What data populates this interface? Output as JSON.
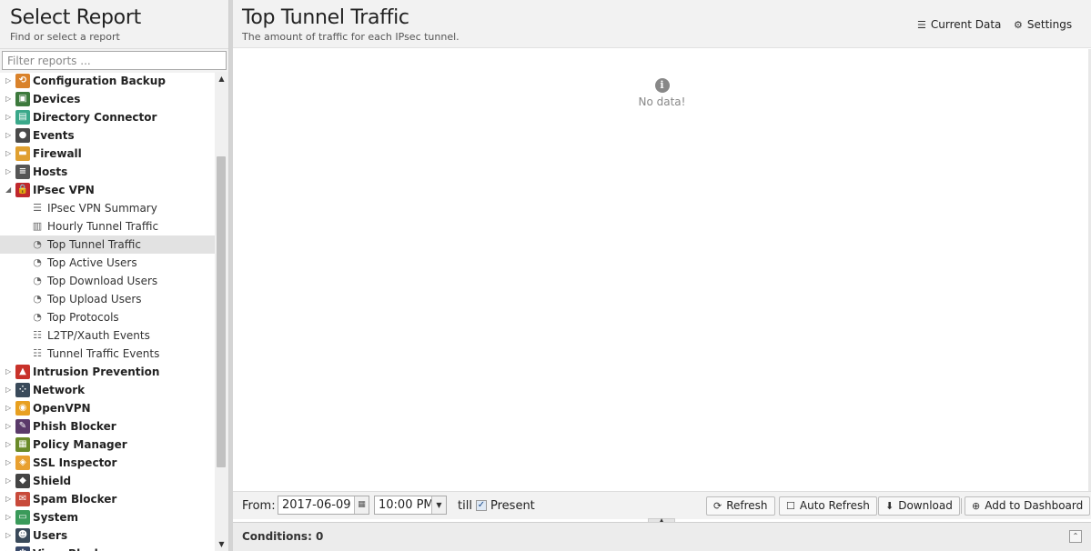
{
  "sidebar": {
    "title": "Select Report",
    "subtitle": "Find or select a report",
    "filter_placeholder": "Filter reports ...",
    "categories": [
      {
        "label": "Configuration Backup",
        "icon": "config-backup-icon",
        "color": "#d9822b",
        "glyph": "⟲",
        "expanded": false
      },
      {
        "label": "Devices",
        "icon": "devices-icon",
        "color": "#3d7a3d",
        "glyph": "▣",
        "expanded": false
      },
      {
        "label": "Directory Connector",
        "icon": "directory-connector-icon",
        "color": "#3aa88a",
        "glyph": "▤",
        "expanded": false
      },
      {
        "label": "Events",
        "icon": "events-icon",
        "color": "#4a4a4a",
        "glyph": "●",
        "expanded": false
      },
      {
        "label": "Firewall",
        "icon": "firewall-icon",
        "color": "#e0a030",
        "glyph": "▬",
        "expanded": false
      },
      {
        "label": "Hosts",
        "icon": "hosts-icon",
        "color": "#555555",
        "glyph": "≡",
        "expanded": false
      },
      {
        "label": "IPsec VPN",
        "icon": "ipsec-vpn-icon",
        "color": "#c0282d",
        "glyph": "🔒",
        "expanded": true,
        "children": [
          {
            "label": "IPsec VPN Summary",
            "icon": "text-lines-icon",
            "glyph": "☰"
          },
          {
            "label": "Hourly Tunnel Traffic",
            "icon": "bar-chart-icon",
            "glyph": "▥"
          },
          {
            "label": "Top Tunnel Traffic",
            "icon": "pie-chart-icon",
            "glyph": "◔",
            "selected": true
          },
          {
            "label": "Top Active Users",
            "icon": "pie-chart-icon",
            "glyph": "◔"
          },
          {
            "label": "Top Download Users",
            "icon": "pie-chart-icon",
            "glyph": "◔"
          },
          {
            "label": "Top Upload Users",
            "icon": "pie-chart-icon",
            "glyph": "◔"
          },
          {
            "label": "Top Protocols",
            "icon": "pie-chart-icon",
            "glyph": "◔"
          },
          {
            "label": "L2TP/Xauth Events",
            "icon": "list-icon",
            "glyph": "☷"
          },
          {
            "label": "Tunnel Traffic Events",
            "icon": "list-icon",
            "glyph": "☷"
          }
        ]
      },
      {
        "label": "Intrusion Prevention",
        "icon": "intrusion-prevention-icon",
        "color": "#c8322a",
        "glyph": "▲",
        "expanded": false
      },
      {
        "label": "Network",
        "icon": "network-icon",
        "color": "#3a4a5a",
        "glyph": "⁘",
        "expanded": false
      },
      {
        "label": "OpenVPN",
        "icon": "openvpn-icon",
        "color": "#e8a020",
        "glyph": "◉",
        "expanded": false
      },
      {
        "label": "Phish Blocker",
        "icon": "phish-blocker-icon",
        "color": "#5a3a6a",
        "glyph": "✎",
        "expanded": false
      },
      {
        "label": "Policy Manager",
        "icon": "policy-manager-icon",
        "color": "#6a8a2a",
        "glyph": "▦",
        "expanded": false
      },
      {
        "label": "SSL Inspector",
        "icon": "ssl-inspector-icon",
        "color": "#e8a030",
        "glyph": "◈",
        "expanded": false
      },
      {
        "label": "Shield",
        "icon": "shield-icon",
        "color": "#444444",
        "glyph": "◆",
        "expanded": false
      },
      {
        "label": "Spam Blocker",
        "icon": "spam-blocker-icon",
        "color": "#c84a3a",
        "glyph": "✉",
        "expanded": false
      },
      {
        "label": "System",
        "icon": "system-icon",
        "color": "#3a9a5a",
        "glyph": "▭",
        "expanded": false
      },
      {
        "label": "Users",
        "icon": "users-icon",
        "color": "#3a4a5a",
        "glyph": "☻",
        "expanded": false
      },
      {
        "label": "Virus Blocker",
        "icon": "virus-blocker-icon",
        "color": "#3a4a6a",
        "glyph": "✱",
        "expanded": false
      }
    ]
  },
  "report": {
    "title": "Top Tunnel Traffic",
    "subtitle": "The amount of traffic for each IPsec tunnel.",
    "current_data_label": "Current Data",
    "settings_label": "Settings",
    "no_data_text": "No data!"
  },
  "toolbar": {
    "from_label": "From:",
    "date_value": "2017-06-09",
    "time_value": "10:00 PM",
    "till_label": "till",
    "present_label": "Present",
    "present_checked": true,
    "refresh_label": "Refresh",
    "auto_refresh_label": "Auto Refresh",
    "download_label": "Download",
    "add_dashboard_label": "Add to Dashboard"
  },
  "conditions": {
    "label": "Conditions: 0"
  }
}
